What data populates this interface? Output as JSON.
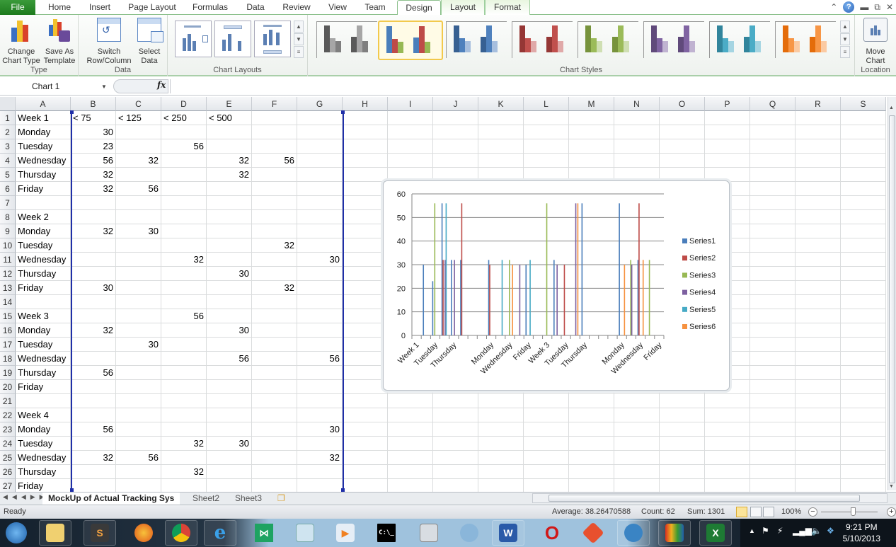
{
  "ribbon_tabs": [
    {
      "label": "File"
    },
    {
      "label": "Home"
    },
    {
      "label": "Insert"
    },
    {
      "label": "Page Layout"
    },
    {
      "label": "Formulas"
    },
    {
      "label": "Data"
    },
    {
      "label": "Review"
    },
    {
      "label": "View"
    },
    {
      "label": "Team"
    },
    {
      "label": "Design"
    },
    {
      "label": "Layout"
    },
    {
      "label": "Format"
    }
  ],
  "active_tab": "Design",
  "ribbon": {
    "type_group": {
      "label": "Type",
      "change_chart_type": [
        "Change",
        "Chart Type"
      ],
      "save_as_template": [
        "Save As",
        "Template"
      ]
    },
    "data_group": {
      "label": "Data",
      "switch_row_column": [
        "Switch",
        "Row/Column"
      ],
      "select_data": [
        "Select",
        "Data"
      ]
    },
    "layouts_group": {
      "label": "Chart Layouts"
    },
    "styles_group": {
      "label": "Chart Styles",
      "styles": [
        {
          "name": "Gray",
          "colors": [
            "#5a5a5a",
            "#a6a6a6",
            "#7f7f7f"
          ]
        },
        {
          "name": "Colorful",
          "colors": [
            "#4a7ebb",
            "#be4b48",
            "#98b954"
          ],
          "selected": true
        },
        {
          "name": "Blue",
          "colors": [
            "#376092",
            "#4f81bd",
            "#a7bfde"
          ]
        },
        {
          "name": "Red",
          "colors": [
            "#953735",
            "#c0504d",
            "#e0a9a8"
          ]
        },
        {
          "name": "Green",
          "colors": [
            "#77933c",
            "#9bbb59",
            "#cfdfb3"
          ]
        },
        {
          "name": "Purple",
          "colors": [
            "#604a7b",
            "#8064a2",
            "#c0b3d1"
          ]
        },
        {
          "name": "Aqua",
          "colors": [
            "#31859c",
            "#4bacc6",
            "#a5d5e2"
          ]
        },
        {
          "name": "Orange",
          "colors": [
            "#e46c0a",
            "#f79646",
            "#fbcaa2"
          ]
        }
      ]
    },
    "location_group": {
      "label": "Location",
      "move_chart": [
        "Move",
        "Chart"
      ]
    }
  },
  "formula_bar": {
    "name_box": "Chart 1",
    "fx_label": "fx",
    "formula": ""
  },
  "columns": [
    "A",
    "B",
    "C",
    "D",
    "E",
    "F",
    "G",
    "H",
    "I",
    "J",
    "K",
    "L",
    "M",
    "N",
    "O",
    "P",
    "Q",
    "R",
    "S"
  ],
  "rows": [
    [
      "Week 1",
      "< 75",
      "< 125",
      "< 250",
      "< 500",
      "",
      ""
    ],
    [
      "Monday",
      "30",
      "",
      "",
      "",
      "",
      ""
    ],
    [
      "Tuesday",
      "23",
      "",
      "56",
      "",
      "",
      ""
    ],
    [
      "Wednesday",
      "56",
      "32",
      "",
      "32",
      "56",
      ""
    ],
    [
      "Thursday",
      "32",
      "",
      "",
      "32",
      "",
      ""
    ],
    [
      "Friday",
      "32",
      "56",
      "",
      "",
      "",
      ""
    ],
    [
      "",
      "",
      "",
      "",
      "",
      "",
      ""
    ],
    [
      "Week 2",
      "",
      "",
      "",
      "",
      "",
      ""
    ],
    [
      "Monday",
      "32",
      "30",
      "",
      "",
      "",
      ""
    ],
    [
      "Tuesday",
      "",
      "",
      "",
      "",
      "32",
      ""
    ],
    [
      "Wednesday",
      "",
      "",
      "32",
      "",
      "",
      "30"
    ],
    [
      "Thursday",
      "",
      "",
      "",
      "30",
      "",
      ""
    ],
    [
      "Friday",
      "30",
      "",
      "",
      "",
      "32",
      ""
    ],
    [
      "",
      "",
      "",
      "",
      "",
      "",
      ""
    ],
    [
      "Week 3",
      "",
      "",
      "56",
      "",
      "",
      ""
    ],
    [
      "Monday",
      "32",
      "",
      "",
      "30",
      "",
      ""
    ],
    [
      "Tuesday",
      "",
      "30",
      "",
      "",
      "",
      ""
    ],
    [
      "Wednesday",
      "",
      "",
      "",
      "56",
      "",
      "56"
    ],
    [
      "Thursday",
      "56",
      "",
      "",
      "",
      "",
      ""
    ],
    [
      "Friday",
      "",
      "",
      "",
      "",
      "",
      ""
    ],
    [
      "",
      "",
      "",
      "",
      "",
      "",
      ""
    ],
    [
      "Week 4",
      "",
      "",
      "",
      "",
      "",
      ""
    ],
    [
      "Monday",
      "56",
      "",
      "",
      "",
      "",
      "30"
    ],
    [
      "Tuesday",
      "",
      "",
      "32",
      "30",
      "",
      ""
    ],
    [
      "Wednesday",
      "32",
      "56",
      "",
      "",
      "",
      "32"
    ],
    [
      "Thursday",
      "",
      "",
      "32",
      "",
      "",
      ""
    ],
    [
      "Friday",
      "",
      "",
      "",
      "",
      "",
      ""
    ]
  ],
  "chart_data": {
    "type": "bar",
    "title": "",
    "xlabel": "",
    "ylabel": "",
    "ylim": [
      0,
      60
    ],
    "yticks": [
      0,
      10,
      20,
      30,
      40,
      50,
      60
    ],
    "grid": true,
    "legend": "right",
    "categories": [
      "Week 1",
      "Monday",
      "Tuesday",
      "Wednesday",
      "Thursday",
      "Friday",
      "",
      "Week 2",
      "Monday",
      "Tuesday",
      "Wednesday",
      "Thursday",
      "Friday",
      "",
      "Week 3",
      "Monday",
      "Tuesday",
      "Wednesday",
      "Thursday",
      "Friday",
      "",
      "Week 4",
      "Monday",
      "Tuesday",
      "Wednesday",
      "Thursday",
      "Friday"
    ],
    "xtick_labels": [
      "Week 1",
      "",
      "Tuesday",
      "",
      "Thursday",
      "",
      "",
      "",
      "Monday",
      "",
      "Wednesday",
      "",
      "Friday",
      "",
      "Week 3",
      "",
      "Tuesday",
      "",
      "Thursday",
      "",
      "",
      "",
      "Monday",
      "",
      "Wednesday",
      "",
      "Friday"
    ],
    "series": [
      {
        "name": "Series1",
        "color": "#4a7ebb",
        "values": [
          null,
          30,
          23,
          56,
          32,
          32,
          null,
          null,
          32,
          null,
          null,
          null,
          30,
          null,
          null,
          32,
          null,
          null,
          56,
          null,
          null,
          null,
          56,
          null,
          32,
          null,
          null
        ]
      },
      {
        "name": "Series2",
        "color": "#be4b48",
        "values": [
          null,
          null,
          null,
          32,
          null,
          56,
          null,
          null,
          30,
          null,
          null,
          null,
          null,
          null,
          null,
          null,
          30,
          null,
          null,
          null,
          null,
          null,
          null,
          null,
          56,
          null,
          null
        ]
      },
      {
        "name": "Series3",
        "color": "#98b954",
        "values": [
          null,
          null,
          56,
          null,
          null,
          null,
          null,
          null,
          null,
          null,
          32,
          null,
          null,
          null,
          56,
          null,
          null,
          null,
          null,
          null,
          null,
          null,
          null,
          32,
          null,
          32,
          null
        ]
      },
      {
        "name": "Series4",
        "color": "#7d60a0",
        "values": [
          null,
          null,
          null,
          32,
          32,
          null,
          null,
          null,
          null,
          null,
          null,
          30,
          null,
          null,
          null,
          30,
          null,
          56,
          null,
          null,
          null,
          null,
          null,
          30,
          null,
          null,
          null
        ]
      },
      {
        "name": "Series5",
        "color": "#46aac5",
        "values": [
          null,
          null,
          null,
          56,
          null,
          null,
          null,
          null,
          null,
          32,
          null,
          null,
          32,
          null,
          null,
          null,
          null,
          null,
          null,
          null,
          null,
          null,
          null,
          null,
          null,
          null,
          null
        ]
      },
      {
        "name": "Series6",
        "color": "#f69240",
        "values": [
          null,
          null,
          null,
          null,
          null,
          null,
          null,
          null,
          null,
          null,
          30,
          null,
          null,
          null,
          null,
          null,
          null,
          56,
          null,
          null,
          null,
          null,
          30,
          null,
          32,
          null,
          null
        ]
      }
    ]
  },
  "sheet_tabs": [
    {
      "label": "MockUp of Actual Tracking Sys",
      "active": true
    },
    {
      "label": "Sheet2"
    },
    {
      "label": "Sheet3"
    }
  ],
  "status": {
    "mode": "Ready",
    "average": "Average: 38.26470588",
    "count": "Count: 62",
    "sum": "Sum: 1301",
    "zoom": "100%",
    "zoom_level_percent": 100
  },
  "taskbar": {
    "apps": [
      {
        "name": "start"
      },
      {
        "name": "file-explorer"
      },
      {
        "name": "sublime-text",
        "glyph": "S"
      },
      {
        "name": "firefox"
      },
      {
        "name": "chrome"
      },
      {
        "name": "internet-explorer",
        "glyph": "e"
      },
      {
        "name": "visual-studio"
      },
      {
        "name": "notepad"
      },
      {
        "name": "media-player"
      },
      {
        "name": "command-prompt",
        "glyph": "C:\\_"
      },
      {
        "name": "network-computer"
      },
      {
        "name": "magnifier"
      },
      {
        "name": "word",
        "glyph": "W"
      },
      {
        "name": "opera",
        "glyph": "O"
      },
      {
        "name": "git"
      },
      {
        "name": "github"
      },
      {
        "name": "avg"
      },
      {
        "name": "excel",
        "glyph": "X"
      }
    ],
    "time": "9:21 PM",
    "date": "5/10/2013"
  }
}
